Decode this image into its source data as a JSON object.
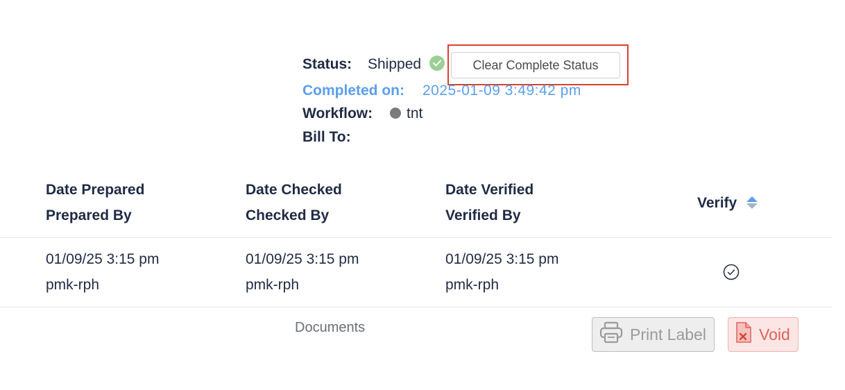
{
  "shipment": {
    "status_label": "Status:",
    "status_value": "Shipped",
    "clear_button_label": "Clear Complete Status",
    "completed_label": "Completed on:",
    "completed_value": "2025-01-09 3:49:42 pm",
    "workflow_label": "Workflow:",
    "workflow_value": "tnt",
    "bill_to_label": "Bill To:",
    "colors": {
      "status_check": "#9ccf95",
      "completed_text": "#5b9ef0",
      "highlight_border": "#d8412f",
      "workflow_dot": "#7b7b7b"
    }
  },
  "table": {
    "headers": {
      "date_prepared": "Date Prepared",
      "prepared_by": "Prepared By",
      "date_checked": "Date Checked",
      "checked_by": "Checked By",
      "date_verified": "Date Verified",
      "verified_by": "Verified By",
      "verify": "Verify"
    },
    "rows": [
      {
        "date_prepared": "01/09/25 3:15 pm",
        "prepared_by": "pmk-rph",
        "date_checked": "01/09/25 3:15 pm",
        "checked_by": "pmk-rph",
        "date_verified": "01/09/25 3:15 pm",
        "verified_by": "pmk-rph",
        "verify_icon": "check-circle-icon"
      }
    ]
  },
  "footer": {
    "documents_label": "Documents",
    "print_label": "Print Label",
    "print_icon": "printer-icon",
    "void_label": "Void",
    "void_icon": "file-x-icon",
    "colors": {
      "void_text": "#e0615a",
      "void_bg": "#fbe6e5"
    }
  }
}
